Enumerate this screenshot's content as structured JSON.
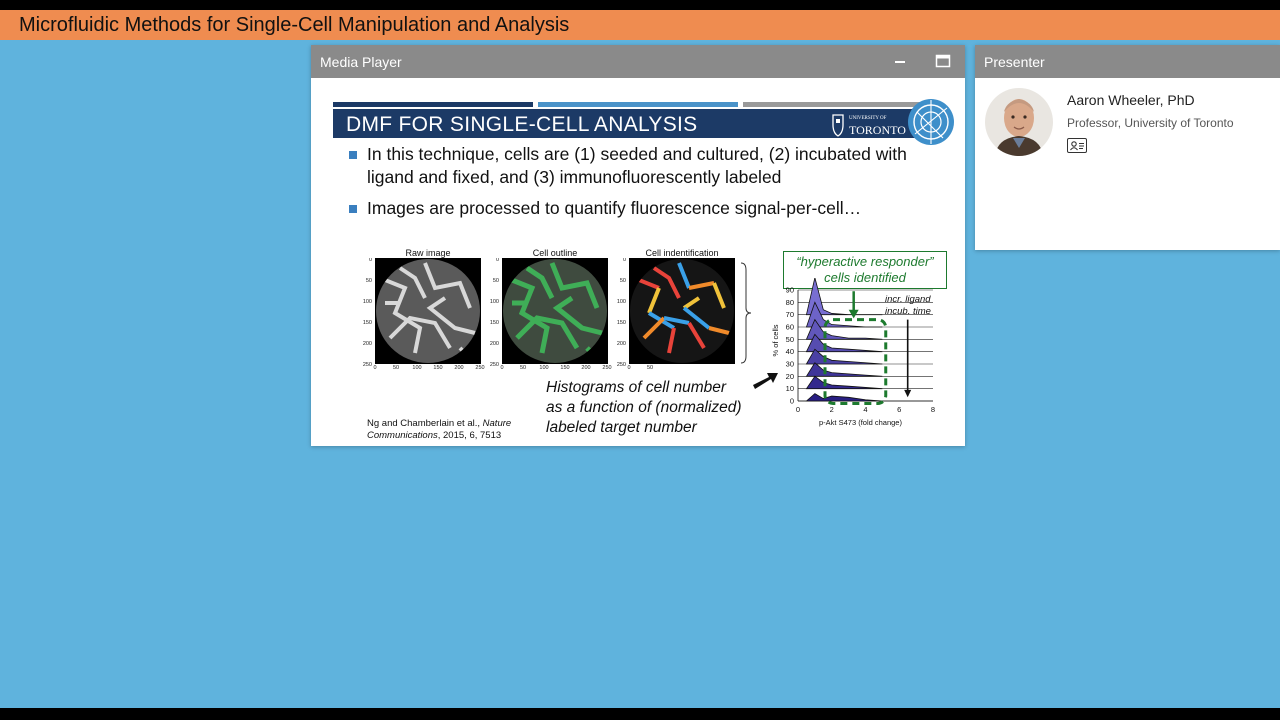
{
  "app": {
    "title": "Microfluidic Methods for Single-Cell Manipulation and Analysis"
  },
  "media_player": {
    "title": "Media Player",
    "minimize_label": "—",
    "maximize_label": "▭",
    "slide": {
      "heading": "DMF FOR SINGLE-CELL ANALYSIS",
      "university_small": "UNIVERSITY OF",
      "university_big": "TORONTO",
      "bullets": [
        "In this technique, cells are (1) seeded and cultured, (2) incubated with ligand and fixed, and (3) immunofluorescently labeled",
        "Images are processed to quantify fluorescence signal-per-cell…"
      ],
      "image_captions": [
        "Raw  image",
        "Cell outline",
        "Cell indentification"
      ],
      "image_ticks": [
        "0",
        "50",
        "100",
        "150",
        "200",
        "250"
      ],
      "highlight_line1": "“hyperactive responder”",
      "highlight_line2": "cells identified",
      "annotation_line1": "incr. ligand",
      "annotation_line2": "incub. time",
      "histogram_caption": [
        "Histograms of cell number",
        "as a function of (normalized)",
        "labeled target number"
      ],
      "citation_authors": "Ng and Chamberlain et al., ",
      "citation_journal1": "Nature",
      "citation_journal2": "Communications",
      "citation_rest": ", 2015, 6, 7513"
    }
  },
  "presenter": {
    "panel_title": "Presenter",
    "name": "Aaron Wheeler, PhD",
    "role": "Professor, University of Toronto",
    "card_icon": "contact-card-icon"
  },
  "colors": {
    "stage": "#5fb3dd",
    "title_bar": "#ef8c50",
    "panel_header": "#8a8a8a",
    "slide_band": "#1c3a66",
    "highlight_green": "#1d7a2e"
  },
  "chart_data": {
    "type": "area",
    "xlabel": "p-Akt S473 (fold change)",
    "ylabel": "% of cells",
    "xlim": [
      0,
      8
    ],
    "ylim": [
      0,
      90
    ],
    "x_ticks": [
      0,
      2,
      4,
      6,
      8
    ],
    "y_ticks": [
      0,
      10,
      20,
      30,
      40,
      50,
      60,
      70,
      80,
      90
    ],
    "series": [
      {
        "offset": 0,
        "x": [
          0.5,
          1.0,
          1.5,
          2.0,
          3.0,
          4.0,
          5.0
        ],
        "values": [
          0,
          6,
          2,
          4,
          3,
          1,
          0
        ]
      },
      {
        "offset": 10,
        "x": [
          0.5,
          1.0,
          1.5,
          2.0,
          3.0,
          4.0,
          5.0
        ],
        "values": [
          0,
          10,
          5,
          3,
          2,
          1,
          0
        ]
      },
      {
        "offset": 20,
        "x": [
          0.5,
          1.0,
          1.5,
          2.0,
          3.0,
          4.0,
          5.0
        ],
        "values": [
          0,
          11,
          5,
          3,
          2,
          1,
          0
        ]
      },
      {
        "offset": 30,
        "x": [
          0.5,
          1.0,
          1.5,
          2.0,
          3.0,
          4.0,
          5.0
        ],
        "values": [
          0,
          12,
          6,
          3,
          2,
          1,
          0
        ]
      },
      {
        "offset": 40,
        "x": [
          0.5,
          1.0,
          1.5,
          2.0,
          3.0,
          4.0,
          5.0
        ],
        "values": [
          0,
          14,
          6,
          3,
          2,
          1,
          0
        ]
      },
      {
        "offset": 50,
        "x": [
          0.5,
          1.0,
          1.5,
          2.0,
          3.0,
          4.0,
          5.0
        ],
        "values": [
          0,
          16,
          6,
          3,
          1,
          1,
          0
        ]
      },
      {
        "offset": 60,
        "x": [
          0.5,
          1.0,
          1.5,
          2.0,
          3.0,
          4.0,
          5.0
        ],
        "values": [
          0,
          20,
          6,
          2,
          1,
          0,
          0
        ]
      },
      {
        "offset": 70,
        "x": [
          0.5,
          1.0,
          1.5,
          2.0,
          3.0,
          4.0,
          5.0
        ],
        "values": [
          0,
          30,
          4,
          1,
          0,
          0,
          0
        ]
      }
    ]
  }
}
